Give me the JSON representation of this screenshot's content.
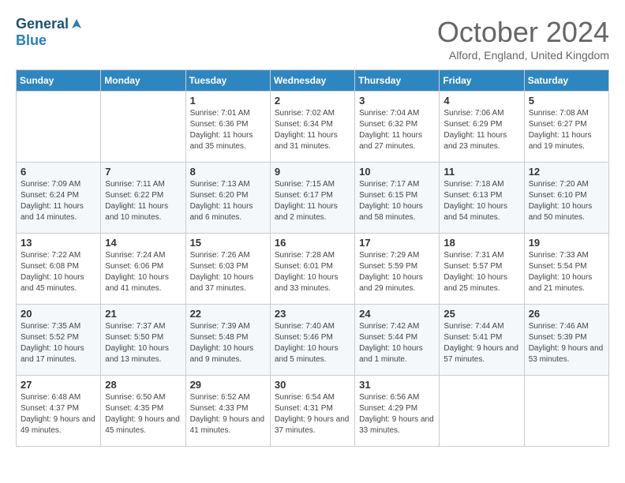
{
  "header": {
    "logo_general": "General",
    "logo_blue": "Blue",
    "title": "October 2024",
    "location": "Alford, England, United Kingdom"
  },
  "columns": [
    "Sunday",
    "Monday",
    "Tuesday",
    "Wednesday",
    "Thursday",
    "Friday",
    "Saturday"
  ],
  "weeks": [
    [
      {
        "day": "",
        "sunrise": "",
        "sunset": "",
        "daylight": ""
      },
      {
        "day": "",
        "sunrise": "",
        "sunset": "",
        "daylight": ""
      },
      {
        "day": "1",
        "sunrise": "Sunrise: 7:01 AM",
        "sunset": "Sunset: 6:36 PM",
        "daylight": "Daylight: 11 hours and 35 minutes."
      },
      {
        "day": "2",
        "sunrise": "Sunrise: 7:02 AM",
        "sunset": "Sunset: 6:34 PM",
        "daylight": "Daylight: 11 hours and 31 minutes."
      },
      {
        "day": "3",
        "sunrise": "Sunrise: 7:04 AM",
        "sunset": "Sunset: 6:32 PM",
        "daylight": "Daylight: 11 hours and 27 minutes."
      },
      {
        "day": "4",
        "sunrise": "Sunrise: 7:06 AM",
        "sunset": "Sunset: 6:29 PM",
        "daylight": "Daylight: 11 hours and 23 minutes."
      },
      {
        "day": "5",
        "sunrise": "Sunrise: 7:08 AM",
        "sunset": "Sunset: 6:27 PM",
        "daylight": "Daylight: 11 hours and 19 minutes."
      }
    ],
    [
      {
        "day": "6",
        "sunrise": "Sunrise: 7:09 AM",
        "sunset": "Sunset: 6:24 PM",
        "daylight": "Daylight: 11 hours and 14 minutes."
      },
      {
        "day": "7",
        "sunrise": "Sunrise: 7:11 AM",
        "sunset": "Sunset: 6:22 PM",
        "daylight": "Daylight: 11 hours and 10 minutes."
      },
      {
        "day": "8",
        "sunrise": "Sunrise: 7:13 AM",
        "sunset": "Sunset: 6:20 PM",
        "daylight": "Daylight: 11 hours and 6 minutes."
      },
      {
        "day": "9",
        "sunrise": "Sunrise: 7:15 AM",
        "sunset": "Sunset: 6:17 PM",
        "daylight": "Daylight: 11 hours and 2 minutes."
      },
      {
        "day": "10",
        "sunrise": "Sunrise: 7:17 AM",
        "sunset": "Sunset: 6:15 PM",
        "daylight": "Daylight: 10 hours and 58 minutes."
      },
      {
        "day": "11",
        "sunrise": "Sunrise: 7:18 AM",
        "sunset": "Sunset: 6:13 PM",
        "daylight": "Daylight: 10 hours and 54 minutes."
      },
      {
        "day": "12",
        "sunrise": "Sunrise: 7:20 AM",
        "sunset": "Sunset: 6:10 PM",
        "daylight": "Daylight: 10 hours and 50 minutes."
      }
    ],
    [
      {
        "day": "13",
        "sunrise": "Sunrise: 7:22 AM",
        "sunset": "Sunset: 6:08 PM",
        "daylight": "Daylight: 10 hours and 45 minutes."
      },
      {
        "day": "14",
        "sunrise": "Sunrise: 7:24 AM",
        "sunset": "Sunset: 6:06 PM",
        "daylight": "Daylight: 10 hours and 41 minutes."
      },
      {
        "day": "15",
        "sunrise": "Sunrise: 7:26 AM",
        "sunset": "Sunset: 6:03 PM",
        "daylight": "Daylight: 10 hours and 37 minutes."
      },
      {
        "day": "16",
        "sunrise": "Sunrise: 7:28 AM",
        "sunset": "Sunset: 6:01 PM",
        "daylight": "Daylight: 10 hours and 33 minutes."
      },
      {
        "day": "17",
        "sunrise": "Sunrise: 7:29 AM",
        "sunset": "Sunset: 5:59 PM",
        "daylight": "Daylight: 10 hours and 29 minutes."
      },
      {
        "day": "18",
        "sunrise": "Sunrise: 7:31 AM",
        "sunset": "Sunset: 5:57 PM",
        "daylight": "Daylight: 10 hours and 25 minutes."
      },
      {
        "day": "19",
        "sunrise": "Sunrise: 7:33 AM",
        "sunset": "Sunset: 5:54 PM",
        "daylight": "Daylight: 10 hours and 21 minutes."
      }
    ],
    [
      {
        "day": "20",
        "sunrise": "Sunrise: 7:35 AM",
        "sunset": "Sunset: 5:52 PM",
        "daylight": "Daylight: 10 hours and 17 minutes."
      },
      {
        "day": "21",
        "sunrise": "Sunrise: 7:37 AM",
        "sunset": "Sunset: 5:50 PM",
        "daylight": "Daylight: 10 hours and 13 minutes."
      },
      {
        "day": "22",
        "sunrise": "Sunrise: 7:39 AM",
        "sunset": "Sunset: 5:48 PM",
        "daylight": "Daylight: 10 hours and 9 minutes."
      },
      {
        "day": "23",
        "sunrise": "Sunrise: 7:40 AM",
        "sunset": "Sunset: 5:46 PM",
        "daylight": "Daylight: 10 hours and 5 minutes."
      },
      {
        "day": "24",
        "sunrise": "Sunrise: 7:42 AM",
        "sunset": "Sunset: 5:44 PM",
        "daylight": "Daylight: 10 hours and 1 minute."
      },
      {
        "day": "25",
        "sunrise": "Sunrise: 7:44 AM",
        "sunset": "Sunset: 5:41 PM",
        "daylight": "Daylight: 9 hours and 57 minutes."
      },
      {
        "day": "26",
        "sunrise": "Sunrise: 7:46 AM",
        "sunset": "Sunset: 5:39 PM",
        "daylight": "Daylight: 9 hours and 53 minutes."
      }
    ],
    [
      {
        "day": "27",
        "sunrise": "Sunrise: 6:48 AM",
        "sunset": "Sunset: 4:37 PM",
        "daylight": "Daylight: 9 hours and 49 minutes."
      },
      {
        "day": "28",
        "sunrise": "Sunrise: 6:50 AM",
        "sunset": "Sunset: 4:35 PM",
        "daylight": "Daylight: 9 hours and 45 minutes."
      },
      {
        "day": "29",
        "sunrise": "Sunrise: 6:52 AM",
        "sunset": "Sunset: 4:33 PM",
        "daylight": "Daylight: 9 hours and 41 minutes."
      },
      {
        "day": "30",
        "sunrise": "Sunrise: 6:54 AM",
        "sunset": "Sunset: 4:31 PM",
        "daylight": "Daylight: 9 hours and 37 minutes."
      },
      {
        "day": "31",
        "sunrise": "Sunrise: 6:56 AM",
        "sunset": "Sunset: 4:29 PM",
        "daylight": "Daylight: 9 hours and 33 minutes."
      },
      {
        "day": "",
        "sunrise": "",
        "sunset": "",
        "daylight": ""
      },
      {
        "day": "",
        "sunrise": "",
        "sunset": "",
        "daylight": ""
      }
    ]
  ]
}
